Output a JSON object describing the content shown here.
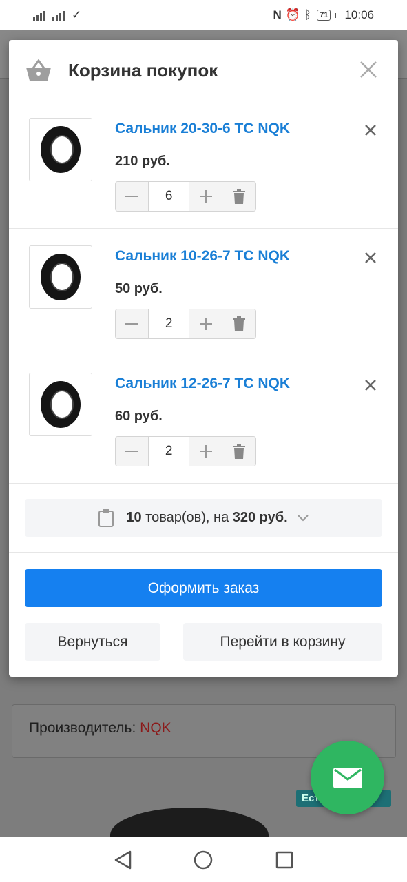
{
  "status_bar": {
    "time": "10:06",
    "battery": "71"
  },
  "background_page": {
    "manufacturer_label": "Производитель: ",
    "manufacturer_value": "NQK",
    "tag_left": "Ест",
    "tag_right": "и"
  },
  "modal": {
    "title": "Корзина покупок",
    "items": [
      {
        "name": "Сальник 20-30-6 TC NQK",
        "price": "210 руб.",
        "qty": "6"
      },
      {
        "name": "Сальник 10-26-7 TC NQK",
        "price": "50 руб.",
        "qty": "2"
      },
      {
        "name": "Сальник 12-26-7 TC NQK",
        "price": "60 руб.",
        "qty": "2"
      }
    ],
    "summary": {
      "count": "10",
      "count_suffix": " товар(ов), на ",
      "total": "320 руб."
    },
    "checkout_label": "Оформить заказ",
    "back_label": "Вернуться",
    "cart_label": "Перейти в корзину"
  },
  "colors": {
    "accent": "#1580f0",
    "link": "#1a7fd6",
    "fab": "#2fb661"
  },
  "icons": [
    "basket-icon",
    "close-icon",
    "remove-icon",
    "minus-icon",
    "plus-icon",
    "trash-icon",
    "clipboard-icon",
    "chevron-down-icon",
    "mail-icon",
    "nav-back-icon",
    "nav-home-icon",
    "nav-recents-icon"
  ]
}
